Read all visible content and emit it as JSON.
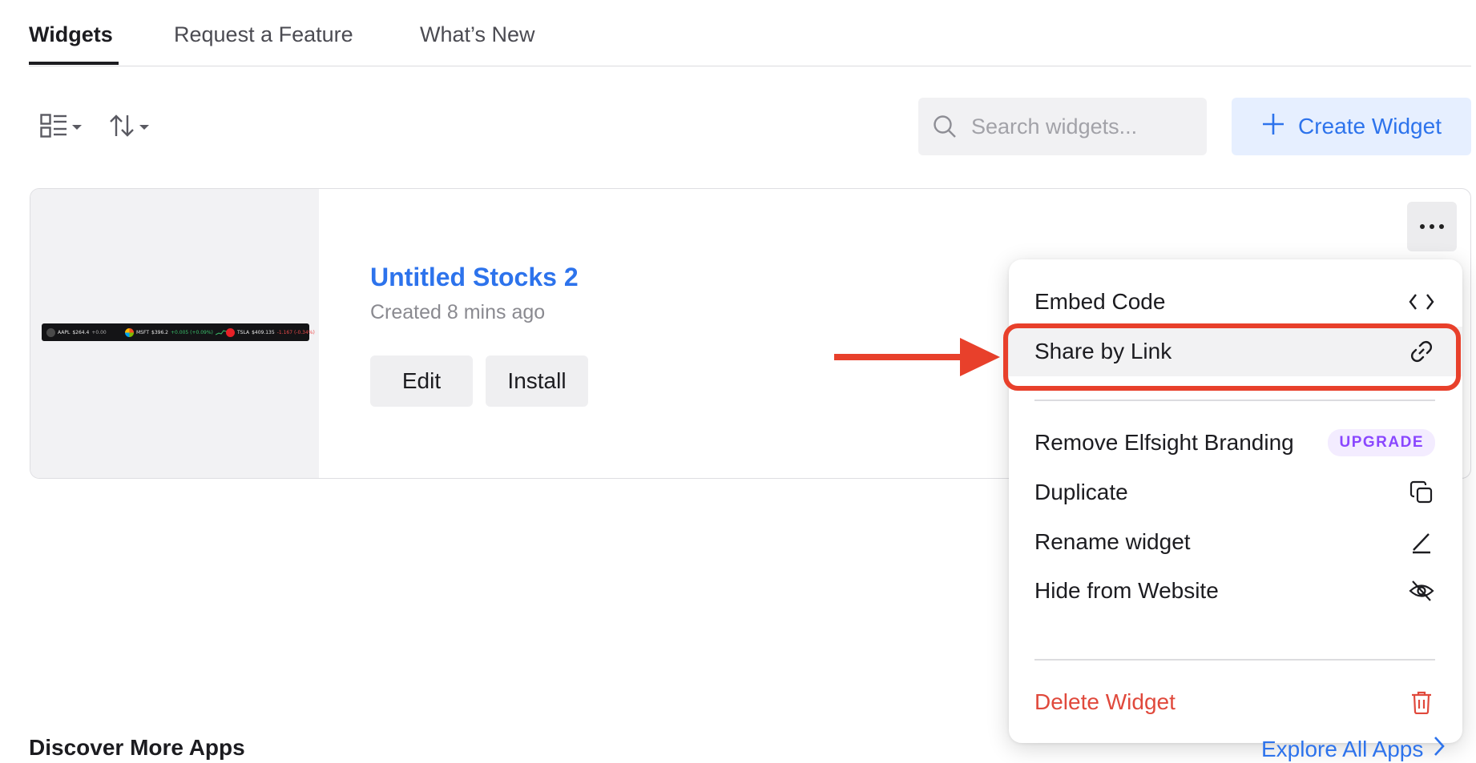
{
  "tabs": [
    {
      "label": "Widgets",
      "active": true
    },
    {
      "label": "Request a Feature",
      "active": false
    },
    {
      "label": "What’s New",
      "active": false
    }
  ],
  "toolbar": {
    "layout_icon": "list-layout-icon",
    "sort_icon": "sort-arrows-icon",
    "search_placeholder": "Search widgets...",
    "create_label": "Create Widget"
  },
  "widget": {
    "title": "Untitled Stocks 2",
    "created": "Created 8 mins ago",
    "edit_label": "Edit",
    "install_label": "Install",
    "preview": {
      "tickers": [
        {
          "symbol": "AAPL",
          "price": "$264.4",
          "change": "+0.00",
          "trend": "neutral",
          "color": "#4a4a4a"
        },
        {
          "symbol": "MSFT",
          "price": "$396.2",
          "change": "+0.005 (+0.09%)",
          "trend": "up",
          "color": "#f1a33a"
        },
        {
          "symbol": "TSLA",
          "price": "$409.135",
          "change": "-1.167 (-0.34%)",
          "trend": "down",
          "color": "#e82127"
        }
      ]
    }
  },
  "menu": {
    "items": [
      {
        "label": "Embed Code",
        "icon": "code-brackets-icon"
      },
      {
        "label": "Share by Link",
        "icon": "link-icon",
        "highlighted": true
      },
      {
        "label": "Remove Elfsight Branding",
        "badge": "UPGRADE"
      },
      {
        "label": "Duplicate",
        "icon": "duplicate-icon"
      },
      {
        "label": "Rename widget",
        "icon": "pencil-icon"
      },
      {
        "label": "Hide from Website",
        "icon": "eye-off-icon"
      },
      {
        "label": "Delete Widget",
        "icon": "trash-icon",
        "danger": true
      }
    ]
  },
  "annotation": {
    "arrow_color": "#e8402b"
  },
  "footer": {
    "discover_label": "Discover More Apps",
    "explore_label": "Explore All Apps"
  },
  "colors": {
    "accent": "#2d73ec",
    "danger": "#e0493c",
    "upgrade": "#8a47ff"
  }
}
